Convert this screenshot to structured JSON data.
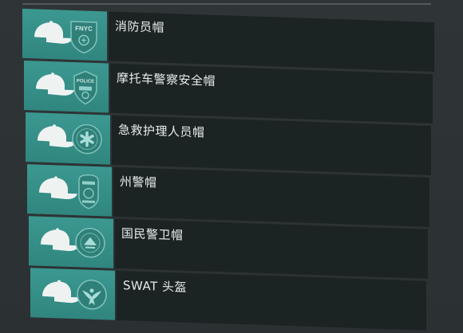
{
  "hat_list": {
    "items": [
      {
        "label": "消防员帽",
        "badge_icon": "fnyc-badge-icon",
        "badge_text": "FNYC"
      },
      {
        "label": "摩托车警察安全帽",
        "badge_icon": "police-badge-icon",
        "badge_text": "POLICE"
      },
      {
        "label": "急救护理人员帽",
        "badge_icon": "star-of-life-icon",
        "badge_text": ""
      },
      {
        "label": "州警帽",
        "badge_icon": "state-police-badge-icon",
        "badge_text": ""
      },
      {
        "label": "国民警卫帽",
        "badge_icon": "national-guard-emblem-icon",
        "badge_text": ""
      },
      {
        "label": "SWAT 头盔",
        "badge_icon": "eagle-emblem-icon",
        "badge_text": ""
      }
    ]
  },
  "colors": {
    "thumb_bg": "#3b9890",
    "panel_bg": "#1c2323",
    "text": "#e6eceb",
    "page_bg": "#2c3234"
  }
}
